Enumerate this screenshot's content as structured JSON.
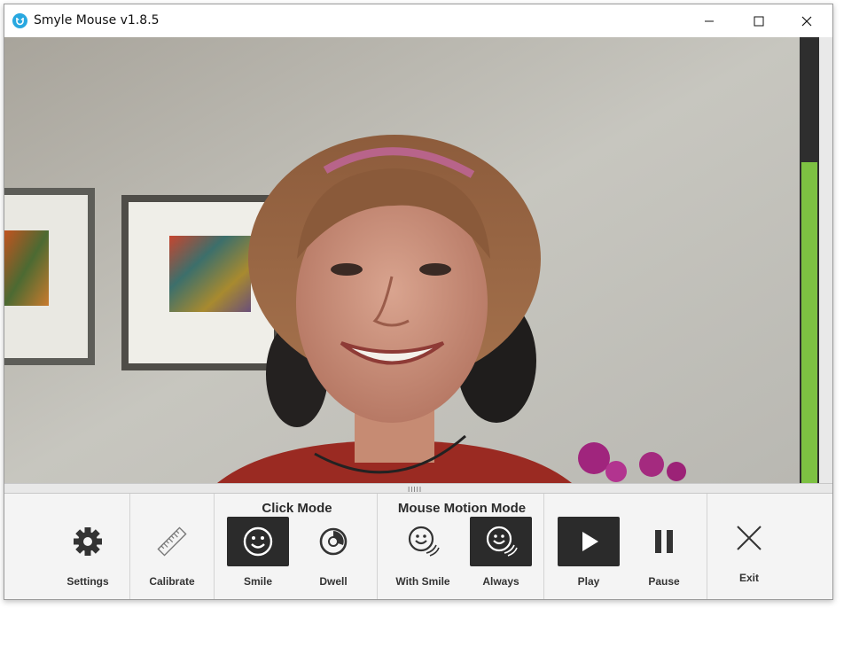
{
  "window": {
    "title": "Smyle Mouse v1.8.5",
    "minimize_icon": "minimize-icon",
    "maximize_icon": "maximize-icon",
    "close_icon": "close-icon"
  },
  "meter": {
    "level": 0.72,
    "color": "#7dc142"
  },
  "toolbar": {
    "settings_label": "Settings",
    "calibrate_label": "Calibrate",
    "click_mode": {
      "title": "Click Mode",
      "smile_label": "Smile",
      "dwell_label": "Dwell",
      "selected": "Smile"
    },
    "motion_mode": {
      "title": "Mouse Motion Mode",
      "with_smile_label": "With Smile",
      "always_label": "Always",
      "selected": "Always"
    },
    "play_label": "Play",
    "pause_label": "Pause",
    "exit_label": "Exit",
    "active_state": "Play"
  },
  "colors": {
    "accent_dark": "#2b2b2b",
    "meter_green": "#7dc142",
    "app_icon": "#29a8e0"
  }
}
